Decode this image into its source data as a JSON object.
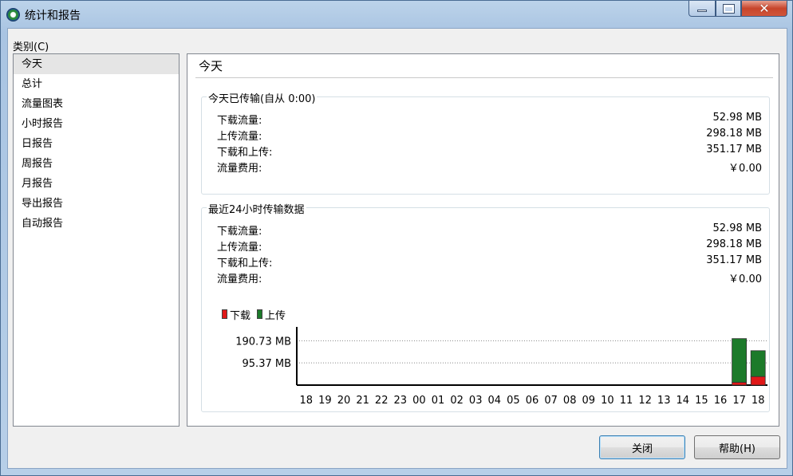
{
  "window": {
    "title": "统计和报告",
    "minimize_label": "—",
    "maximize_label": "□",
    "close_label": "✕"
  },
  "sidebar": {
    "label": "类别(C)",
    "items": [
      {
        "label": "今天",
        "selected": true
      },
      {
        "label": "总计"
      },
      {
        "label": "流量图表"
      },
      {
        "label": "小时报告"
      },
      {
        "label": "日报告"
      },
      {
        "label": "周报告"
      },
      {
        "label": "月报告"
      },
      {
        "label": "导出报告"
      },
      {
        "label": "自动报告"
      }
    ]
  },
  "main": {
    "title": "今天",
    "today_group": {
      "title": "今天已传输(自从 0:00)",
      "rows": [
        {
          "label": "下载流量:",
          "value": "52.98 MB"
        },
        {
          "label": "上传流量:",
          "value": "298.18 MB"
        },
        {
          "label": "下载和上传:",
          "value": "351.17 MB"
        },
        {
          "label": "流量费用:",
          "value": "￥0.00"
        }
      ]
    },
    "recent_group": {
      "title": "最近24小时传输数据",
      "rows": [
        {
          "label": "下载流量:",
          "value": "52.98 MB"
        },
        {
          "label": "上传流量:",
          "value": "298.18 MB"
        },
        {
          "label": "下载和上传:",
          "value": "351.17 MB"
        },
        {
          "label": "流量费用:",
          "value": "￥0.00"
        }
      ]
    }
  },
  "chart_data": {
    "type": "bar",
    "legend": [
      {
        "name": "下载",
        "color": "#e01818"
      },
      {
        "name": "上传",
        "color": "#1c7a2a"
      }
    ],
    "y_tick_labels": [
      "190.73 MB",
      "95.37 MB"
    ],
    "y_ticks": [
      190.73,
      95.37
    ],
    "ylim": [
      0,
      240
    ],
    "categories": [
      "18",
      "19",
      "20",
      "21",
      "22",
      "23",
      "00",
      "01",
      "02",
      "03",
      "04",
      "05",
      "06",
      "07",
      "08",
      "09",
      "10",
      "11",
      "12",
      "13",
      "14",
      "15",
      "16",
      "17",
      "18"
    ],
    "series": [
      {
        "name": "下载",
        "values": [
          0,
          0,
          0,
          0,
          0,
          0,
          0,
          0,
          0,
          0,
          0,
          0,
          0,
          0,
          0,
          0,
          0,
          0,
          0,
          0,
          0,
          0,
          0,
          12,
          37
        ]
      },
      {
        "name": "上传",
        "values": [
          0,
          0,
          0,
          0,
          0,
          0,
          0,
          0,
          0,
          0,
          0,
          0,
          0,
          0,
          0,
          0,
          0,
          0,
          0,
          0,
          0,
          0,
          0,
          188,
          111
        ]
      }
    ],
    "stacked": true,
    "grid": "dotted horizontal"
  },
  "buttons": {
    "close": "关闭",
    "help": "帮助(H)"
  }
}
